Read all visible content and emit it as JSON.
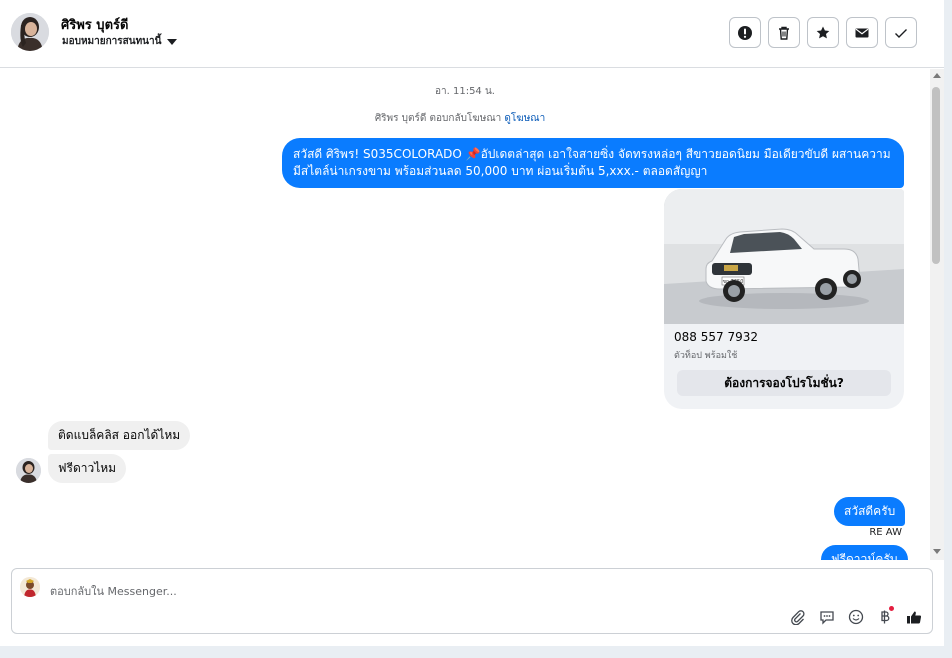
{
  "contact": {
    "name": "ศิริพร บุตร์ดี",
    "assign_label": "มอบหมายการสนทนานี้"
  },
  "actions": [
    {
      "name": "report",
      "icon": "alert-icon"
    },
    {
      "name": "delete",
      "icon": "trash-icon"
    },
    {
      "name": "star",
      "icon": "star-icon"
    },
    {
      "name": "mark-unread",
      "icon": "envelope-icon"
    },
    {
      "name": "mark-done",
      "icon": "check-icon"
    }
  ],
  "thread": {
    "timestamp": "อา. 11:54 น.",
    "reply_note": "ศิริพร บุตร์ดี ตอบกลับโฆษณา",
    "reply_note_link": "ดูโฆษณา",
    "ad_message": "สวัสดี ศิริพร! S035COLORADO 📌อัปเดตล่าสุด เอาใจสายซิ่ง จัดทรงหล่อๆ สีขาวยอดนิยม มือเดียวขับดี ผสานความมีสไตล์น่าเกรงขาม พร้อมส่วนลด 50,000 บาท ผ่อนเริ่มต้น 5,xxx.- ตลอดสัญญา",
    "ad_card": {
      "phone": "088 557 7932",
      "subtitle": "ตัวท็อป พร้อมใช้",
      "cta": "ต้องการจองโปรโมชั่น?",
      "plate": "ขก 7650"
    },
    "incoming": [
      "ติดแบล็คลิส ออกได้ไหม",
      "ฟรีดาวไหม"
    ],
    "outgoing_reply": "สวัสดีครับ",
    "outgoing_sender": "RE AW",
    "outgoing_partial": "ฟรีดาวน์ครับ"
  },
  "composer": {
    "placeholder": "ตอบกลับใน Messenger...",
    "tools": [
      "paperclip-icon",
      "saved-reply-icon",
      "emoji-icon",
      "baht-icon",
      "thumbs-up-icon"
    ]
  },
  "colors": {
    "accent": "#0a7cff",
    "incoming_bubble": "#f0f0f0"
  }
}
